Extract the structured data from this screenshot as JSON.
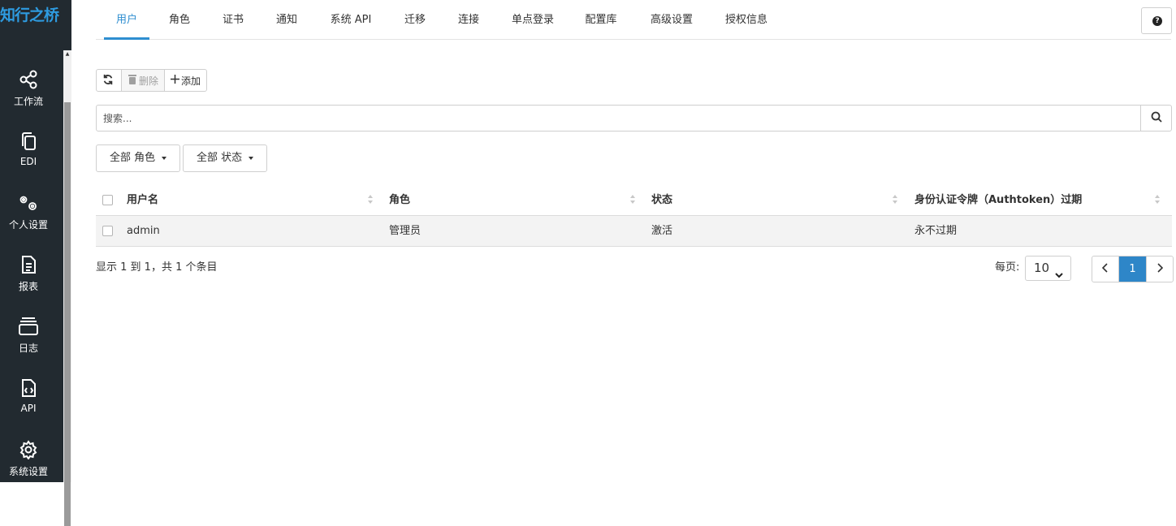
{
  "app": {
    "logo_text": "知行之桥",
    "brand_color": "#2e9be0",
    "sidebar_bg": "#222a30"
  },
  "sidebar": {
    "items": [
      {
        "label": "工作流",
        "icon": "workflow-icon"
      },
      {
        "label": "EDI",
        "icon": "copy-icon"
      },
      {
        "label": "个人设置",
        "icon": "gears-icon"
      },
      {
        "label": "报表",
        "icon": "document-icon"
      },
      {
        "label": "日志",
        "icon": "layers-icon"
      },
      {
        "label": "API",
        "icon": "code-file-icon"
      },
      {
        "label": "系统设置",
        "icon": "gear-icon"
      }
    ]
  },
  "tabs": [
    {
      "label": "用户",
      "active": true
    },
    {
      "label": "角色"
    },
    {
      "label": "证书"
    },
    {
      "label": "通知"
    },
    {
      "label": "系统 API"
    },
    {
      "label": "迁移"
    },
    {
      "label": "连接"
    },
    {
      "label": "单点登录"
    },
    {
      "label": "配置库"
    },
    {
      "label": "高级设置"
    },
    {
      "label": "授权信息"
    }
  ],
  "toolbar": {
    "refresh_icon": "refresh-icon",
    "delete_label": "删除",
    "add_label": "添加"
  },
  "search": {
    "placeholder": "搜索..."
  },
  "filters": {
    "role": "全部 角色",
    "status": "全部 状态"
  },
  "table": {
    "columns": [
      "用户名",
      "角色",
      "状态",
      "身份认证令牌（Authtoken）过期"
    ],
    "rows": [
      [
        "admin",
        "管理员",
        "激活",
        "永不过期"
      ]
    ]
  },
  "footer": {
    "summary": "显示 1 到 1，共 1 个条目",
    "per_page_label": "每页:",
    "per_page_value": "10",
    "pages": [
      "1"
    ],
    "active_page": "1",
    "accent_color": "#2e86c8"
  }
}
